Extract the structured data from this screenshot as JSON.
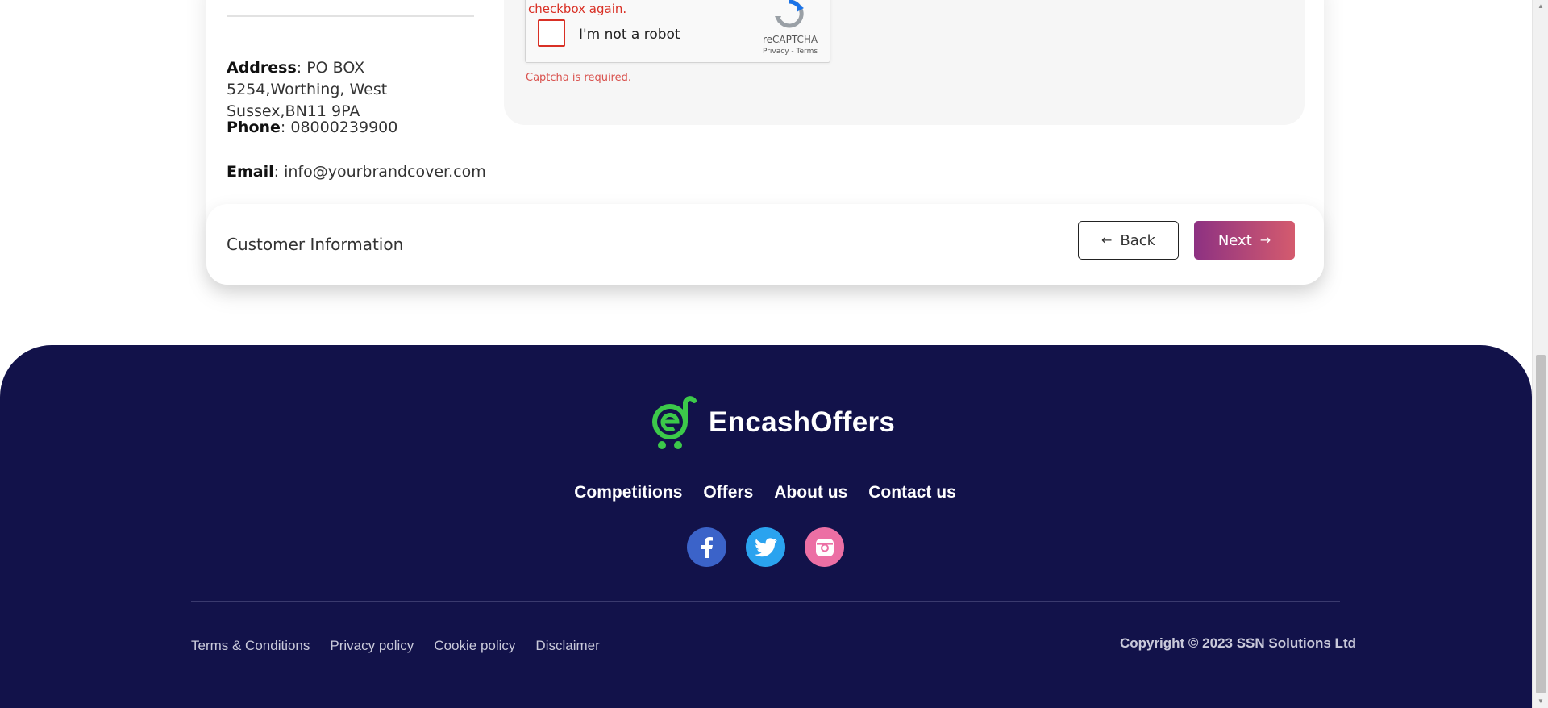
{
  "contact": {
    "address_label": "Address",
    "address_value": ": PO BOX 5254,Worthing, West Sussex,BN11 9PA",
    "phone_label": "Phone",
    "phone_value": ": 08000239900",
    "email_label": "Email",
    "email_value": ": info@yourbrandcover.com"
  },
  "captcha": {
    "error_text": "checkbox again.",
    "checkbox_label": "I'm not a robot",
    "brand": "reCAPTCHA",
    "privacy": "Privacy",
    "separator": " - ",
    "terms": "Terms",
    "required_msg": "Captcha is required."
  },
  "step": {
    "title": "Customer Information",
    "back_label": "Back",
    "next_label": "Next",
    "back_arrow": "←",
    "next_arrow": "→"
  },
  "footer": {
    "brand": "EncashOffers",
    "nav": [
      "Competitions",
      "Offers",
      "About us",
      "Contact us"
    ],
    "social": [
      {
        "name": "facebook",
        "glyph": "f"
      },
      {
        "name": "twitter",
        "glyph": "t"
      },
      {
        "name": "instagram",
        "glyph": "◘"
      }
    ],
    "legal": [
      "Terms & Conditions",
      "Privacy policy",
      "Cookie policy",
      "Disclaimer"
    ],
    "copyright": "Copyright © 2023 SSN Solutions Ltd"
  },
  "colors": {
    "footer_bg": "#12124a",
    "next_gradient_start": "#8d3182",
    "next_gradient_end": "#d45b6e",
    "error": "#d93025",
    "logo_green": "#3cc94a"
  }
}
